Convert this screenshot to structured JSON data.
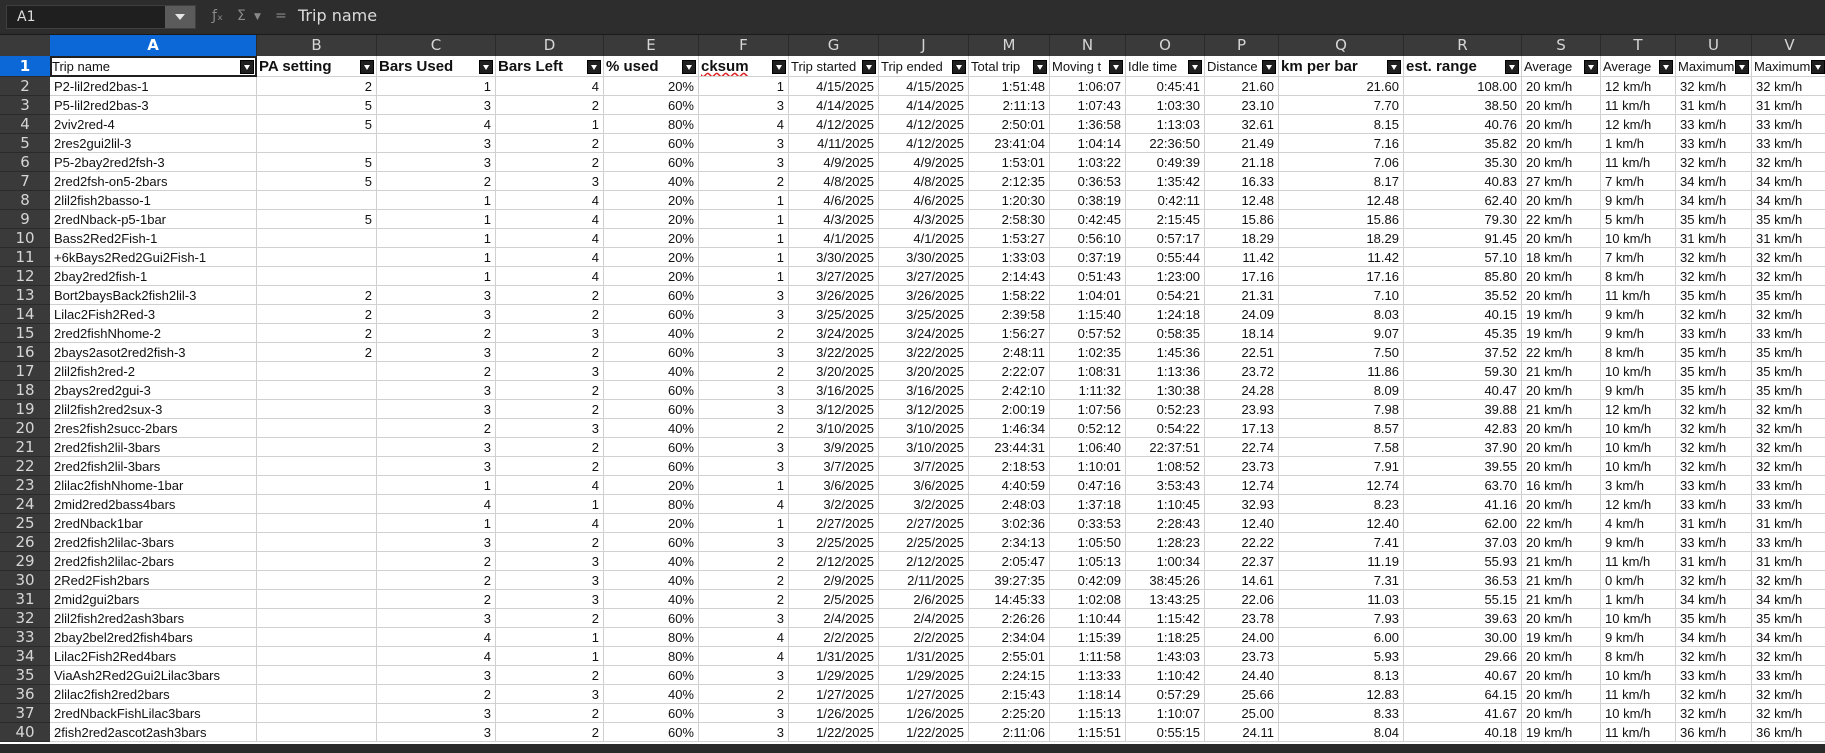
{
  "formula_bar": {
    "name_box": "A1",
    "content": "Trip name",
    "icons": [
      "function-wizard-icon",
      "sum-icon",
      "formula-icon"
    ]
  },
  "columns": [
    "A",
    "B",
    "C",
    "D",
    "E",
    "F",
    "G",
    "J",
    "M",
    "N",
    "O",
    "P",
    "Q",
    "R",
    "S",
    "T",
    "U",
    "V"
  ],
  "selected_column": "A",
  "headers": [
    "Trip name",
    "PA setting",
    "Bars Used",
    "Bars Left",
    "% used",
    "cksum",
    "Trip started",
    "Trip ended",
    "Total trip",
    "Moving t",
    "Idle time",
    "Distance",
    "km per bar",
    "est. range",
    "Average",
    "Average",
    "Maximum",
    "Maximum"
  ],
  "row_numbers": [
    "1",
    "2",
    "3",
    "4",
    "5",
    "6",
    "7",
    "8",
    "9",
    "10",
    "11",
    "12",
    "13",
    "14",
    "15",
    "16",
    "17",
    "18",
    "19",
    "20",
    "21",
    "22",
    "23",
    "24",
    "25",
    "26",
    "29",
    "30",
    "31",
    "32",
    "33",
    "34",
    "35",
    "36",
    "37",
    "40"
  ],
  "selected_row": "1",
  "rows": [
    [
      "P2-lil2red2bas-1",
      "2",
      "1",
      "4",
      "20%",
      "1",
      "4/15/2025",
      "4/15/2025",
      "1:51:48",
      "1:06:07",
      "0:45:41",
      "21.60",
      "21.60",
      "108.00",
      "20 km/h",
      "12 km/h",
      "32 km/h",
      "32 km/h"
    ],
    [
      "P5-lil2red2bas-3",
      "5",
      "3",
      "2",
      "60%",
      "3",
      "4/14/2025",
      "4/14/2025",
      "2:11:13",
      "1:07:43",
      "1:03:30",
      "23.10",
      "7.70",
      "38.50",
      "20 km/h",
      "11 km/h",
      "31 km/h",
      "31 km/h"
    ],
    [
      "2viv2red-4",
      "5",
      "4",
      "1",
      "80%",
      "4",
      "4/12/2025",
      "4/12/2025",
      "2:50:01",
      "1:36:58",
      "1:13:03",
      "32.61",
      "8.15",
      "40.76",
      "20 km/h",
      "12 km/h",
      "33 km/h",
      "33 km/h"
    ],
    [
      "2res2gui2lil-3",
      "",
      "3",
      "2",
      "60%",
      "3",
      "4/11/2025",
      "4/12/2025",
      "23:41:04",
      "1:04:14",
      "22:36:50",
      "21.49",
      "7.16",
      "35.82",
      "20 km/h",
      "1 km/h",
      "33 km/h",
      "33 km/h"
    ],
    [
      "P5-2bay2red2fsh-3",
      "5",
      "3",
      "2",
      "60%",
      "3",
      "4/9/2025",
      "4/9/2025",
      "1:53:01",
      "1:03:22",
      "0:49:39",
      "21.18",
      "7.06",
      "35.30",
      "20 km/h",
      "11 km/h",
      "32 km/h",
      "32 km/h"
    ],
    [
      "2red2fsh-on5-2bars",
      "5",
      "2",
      "3",
      "40%",
      "2",
      "4/8/2025",
      "4/8/2025",
      "2:12:35",
      "0:36:53",
      "1:35:42",
      "16.33",
      "8.17",
      "40.83",
      "27 km/h",
      "7 km/h",
      "34 km/h",
      "34 km/h"
    ],
    [
      "2lil2fish2basso-1",
      "",
      "1",
      "4",
      "20%",
      "1",
      "4/6/2025",
      "4/6/2025",
      "1:20:30",
      "0:38:19",
      "0:42:11",
      "12.48",
      "12.48",
      "62.40",
      "20 km/h",
      "9 km/h",
      "34 km/h",
      "34 km/h"
    ],
    [
      "2redNback-p5-1bar",
      "5",
      "1",
      "4",
      "20%",
      "1",
      "4/3/2025",
      "4/3/2025",
      "2:58:30",
      "0:42:45",
      "2:15:45",
      "15.86",
      "15.86",
      "79.30",
      "22 km/h",
      "5 km/h",
      "35 km/h",
      "35 km/h"
    ],
    [
      "Bass2Red2Fish-1",
      "",
      "1",
      "4",
      "20%",
      "1",
      "4/1/2025",
      "4/1/2025",
      "1:53:27",
      "0:56:10",
      "0:57:17",
      "18.29",
      "18.29",
      "91.45",
      "20 km/h",
      "10 km/h",
      "31 km/h",
      "31 km/h"
    ],
    [
      "+6kBays2Red2Gui2Fish-1",
      "",
      "1",
      "4",
      "20%",
      "1",
      "3/30/2025",
      "3/30/2025",
      "1:33:03",
      "0:37:19",
      "0:55:44",
      "11.42",
      "11.42",
      "57.10",
      "18 km/h",
      "7 km/h",
      "32 km/h",
      "32 km/h"
    ],
    [
      "2bay2red2fish-1",
      "",
      "1",
      "4",
      "20%",
      "1",
      "3/27/2025",
      "3/27/2025",
      "2:14:43",
      "0:51:43",
      "1:23:00",
      "17.16",
      "17.16",
      "85.80",
      "20 km/h",
      "8 km/h",
      "32 km/h",
      "32 km/h"
    ],
    [
      "Bort2baysBack2fish2lil-3",
      "2",
      "3",
      "2",
      "60%",
      "3",
      "3/26/2025",
      "3/26/2025",
      "1:58:22",
      "1:04:01",
      "0:54:21",
      "21.31",
      "7.10",
      "35.52",
      "20 km/h",
      "11 km/h",
      "35 km/h",
      "35 km/h"
    ],
    [
      "Lilac2Fish2Red-3",
      "2",
      "3",
      "2",
      "60%",
      "3",
      "3/25/2025",
      "3/25/2025",
      "2:39:58",
      "1:15:40",
      "1:24:18",
      "24.09",
      "8.03",
      "40.15",
      "19 km/h",
      "9 km/h",
      "32 km/h",
      "32 km/h"
    ],
    [
      "2red2fishNhome-2",
      "2",
      "2",
      "3",
      "40%",
      "2",
      "3/24/2025",
      "3/24/2025",
      "1:56:27",
      "0:57:52",
      "0:58:35",
      "18.14",
      "9.07",
      "45.35",
      "19 km/h",
      "9 km/h",
      "33 km/h",
      "33 km/h"
    ],
    [
      "2bays2asot2red2fish-3",
      "2",
      "3",
      "2",
      "60%",
      "3",
      "3/22/2025",
      "3/22/2025",
      "2:48:11",
      "1:02:35",
      "1:45:36",
      "22.51",
      "7.50",
      "37.52",
      "22 km/h",
      "8 km/h",
      "35 km/h",
      "35 km/h"
    ],
    [
      "2lil2fish2red-2",
      "",
      "2",
      "3",
      "40%",
      "2",
      "3/20/2025",
      "3/20/2025",
      "2:22:07",
      "1:08:31",
      "1:13:36",
      "23.72",
      "11.86",
      "59.30",
      "21 km/h",
      "10 km/h",
      "35 km/h",
      "35 km/h"
    ],
    [
      "2bays2red2gui-3",
      "",
      "3",
      "2",
      "60%",
      "3",
      "3/16/2025",
      "3/16/2025",
      "2:42:10",
      "1:11:32",
      "1:30:38",
      "24.28",
      "8.09",
      "40.47",
      "20 km/h",
      "9 km/h",
      "35 km/h",
      "35 km/h"
    ],
    [
      "2lil2fish2red2sux-3",
      "",
      "3",
      "2",
      "60%",
      "3",
      "3/12/2025",
      "3/12/2025",
      "2:00:19",
      "1:07:56",
      "0:52:23",
      "23.93",
      "7.98",
      "39.88",
      "21 km/h",
      "12 km/h",
      "32 km/h",
      "32 km/h"
    ],
    [
      "2res2fish2succ-2bars",
      "",
      "2",
      "3",
      "40%",
      "2",
      "3/10/2025",
      "3/10/2025",
      "1:46:34",
      "0:52:12",
      "0:54:22",
      "17.13",
      "8.57",
      "42.83",
      "20 km/h",
      "10 km/h",
      "32 km/h",
      "32 km/h"
    ],
    [
      "2red2fish2lil-3bars",
      "",
      "3",
      "2",
      "60%",
      "3",
      "3/9/2025",
      "3/10/2025",
      "23:44:31",
      "1:06:40",
      "22:37:51",
      "22.74",
      "7.58",
      "37.90",
      "20 km/h",
      "10 km/h",
      "32 km/h",
      "32 km/h"
    ],
    [
      "2red2fish2lil-3bars",
      "",
      "3",
      "2",
      "60%",
      "3",
      "3/7/2025",
      "3/7/2025",
      "2:18:53",
      "1:10:01",
      "1:08:52",
      "23.73",
      "7.91",
      "39.55",
      "20 km/h",
      "10 km/h",
      "32 km/h",
      "32 km/h"
    ],
    [
      "2lilac2fishNhome-1bar",
      "",
      "1",
      "4",
      "20%",
      "1",
      "3/6/2025",
      "3/6/2025",
      "4:40:59",
      "0:47:16",
      "3:53:43",
      "12.74",
      "12.74",
      "63.70",
      "16 km/h",
      "3 km/h",
      "33 km/h",
      "33 km/h"
    ],
    [
      "2mid2red2bass4bars",
      "",
      "4",
      "1",
      "80%",
      "4",
      "3/2/2025",
      "3/2/2025",
      "2:48:03",
      "1:37:18",
      "1:10:45",
      "32.93",
      "8.23",
      "41.16",
      "20 km/h",
      "12 km/h",
      "33 km/h",
      "33 km/h"
    ],
    [
      "2redNback1bar",
      "",
      "1",
      "4",
      "20%",
      "1",
      "2/27/2025",
      "2/27/2025",
      "3:02:36",
      "0:33:53",
      "2:28:43",
      "12.40",
      "12.40",
      "62.00",
      "22 km/h",
      "4 km/h",
      "31 km/h",
      "31 km/h"
    ],
    [
      "2red2fish2lilac-3bars",
      "",
      "3",
      "2",
      "60%",
      "3",
      "2/25/2025",
      "2/25/2025",
      "2:34:13",
      "1:05:50",
      "1:28:23",
      "22.22",
      "7.41",
      "37.03",
      "20 km/h",
      "9 km/h",
      "33 km/h",
      "33 km/h"
    ],
    [
      "2red2fish2lilac-2bars",
      "",
      "2",
      "3",
      "40%",
      "2",
      "2/12/2025",
      "2/12/2025",
      "2:05:47",
      "1:05:13",
      "1:00:34",
      "22.37",
      "11.19",
      "55.93",
      "21 km/h",
      "11 km/h",
      "31 km/h",
      "31 km/h"
    ],
    [
      "2Red2Fish2bars",
      "",
      "2",
      "3",
      "40%",
      "2",
      "2/9/2025",
      "2/11/2025",
      "39:27:35",
      "0:42:09",
      "38:45:26",
      "14.61",
      "7.31",
      "36.53",
      "21 km/h",
      "0 km/h",
      "32 km/h",
      "32 km/h"
    ],
    [
      "2mid2gui2bars",
      "",
      "2",
      "3",
      "40%",
      "2",
      "2/5/2025",
      "2/6/2025",
      "14:45:33",
      "1:02:08",
      "13:43:25",
      "22.06",
      "11.03",
      "55.15",
      "21 km/h",
      "1 km/h",
      "34 km/h",
      "34 km/h"
    ],
    [
      "2lil2fish2red2ash3bars",
      "",
      "3",
      "2",
      "60%",
      "3",
      "2/4/2025",
      "2/4/2025",
      "2:26:26",
      "1:10:44",
      "1:15:42",
      "23.78",
      "7.93",
      "39.63",
      "20 km/h",
      "10 km/h",
      "35 km/h",
      "35 km/h"
    ],
    [
      "2bay2bel2red2fish4bars",
      "",
      "4",
      "1",
      "80%",
      "4",
      "2/2/2025",
      "2/2/2025",
      "2:34:04",
      "1:15:39",
      "1:18:25",
      "24.00",
      "6.00",
      "30.00",
      "19 km/h",
      "9 km/h",
      "34 km/h",
      "34 km/h"
    ],
    [
      "Lilac2Fish2Red4bars",
      "",
      "4",
      "1",
      "80%",
      "4",
      "1/31/2025",
      "1/31/2025",
      "2:55:01",
      "1:11:58",
      "1:43:03",
      "23.73",
      "5.93",
      "29.66",
      "20 km/h",
      "8 km/h",
      "32 km/h",
      "32 km/h"
    ],
    [
      "ViaAsh2Red2Gui2Lilac3bars",
      "",
      "3",
      "2",
      "60%",
      "3",
      "1/29/2025",
      "1/29/2025",
      "2:24:15",
      "1:13:33",
      "1:10:42",
      "24.40",
      "8.13",
      "40.67",
      "20 km/h",
      "10 km/h",
      "33 km/h",
      "33 km/h"
    ],
    [
      "2lilac2fish2red2bars",
      "",
      "2",
      "3",
      "40%",
      "2",
      "1/27/2025",
      "1/27/2025",
      "2:15:43",
      "1:18:14",
      "0:57:29",
      "25.66",
      "12.83",
      "64.15",
      "20 km/h",
      "11 km/h",
      "32 km/h",
      "32 km/h"
    ],
    [
      "2redNbackFishLilac3bars",
      "",
      "3",
      "2",
      "60%",
      "3",
      "1/26/2025",
      "1/26/2025",
      "2:25:20",
      "1:15:13",
      "1:10:07",
      "25.00",
      "8.33",
      "41.67",
      "20 km/h",
      "10 km/h",
      "32 km/h",
      "32 km/h"
    ],
    [
      "2fish2red2ascot2ash3bars",
      "",
      "3",
      "2",
      "60%",
      "3",
      "1/22/2025",
      "1/22/2025",
      "2:11:06",
      "1:15:51",
      "0:55:15",
      "24.11",
      "8.04",
      "40.18",
      "19 km/h",
      "11 km/h",
      "36 km/h",
      "36 km/h"
    ]
  ]
}
